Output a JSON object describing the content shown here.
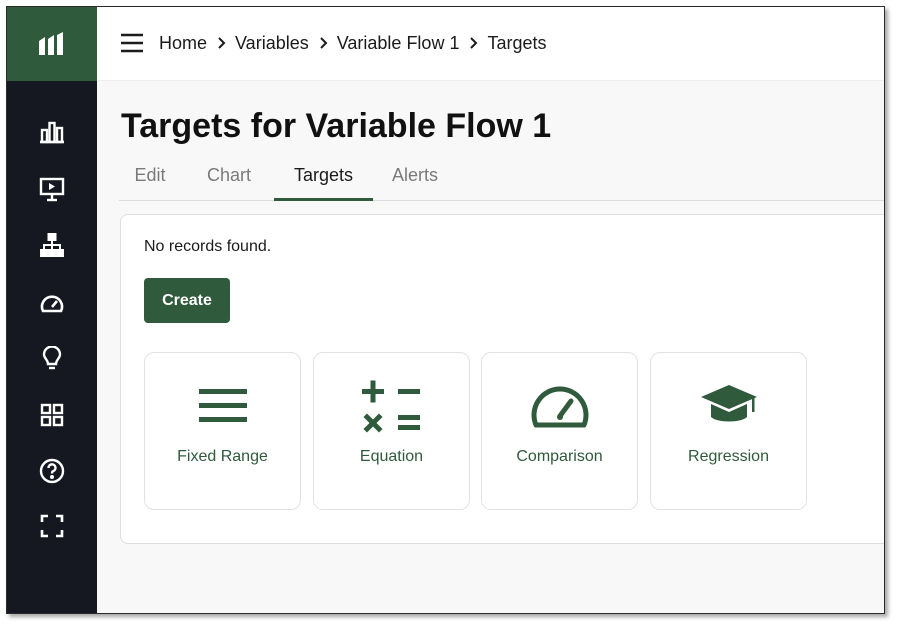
{
  "breadcrumb": [
    "Home",
    "Variables",
    "Variable Flow 1",
    "Targets"
  ],
  "page": {
    "title": "Targets for Variable Flow 1"
  },
  "tabs": [
    {
      "label": "Edit",
      "active": false
    },
    {
      "label": "Chart",
      "active": false
    },
    {
      "label": "Targets",
      "active": true
    },
    {
      "label": "Alerts",
      "active": false
    }
  ],
  "panel": {
    "empty_message": "No records found.",
    "create_label": "Create"
  },
  "target_types": [
    {
      "label": "Fixed Range",
      "icon": "bars-icon"
    },
    {
      "label": "Equation",
      "icon": "math-operators-icon"
    },
    {
      "label": "Comparison",
      "icon": "gauge-icon"
    },
    {
      "label": "Regression",
      "icon": "graduation-cap-icon"
    }
  ],
  "sidebar": {
    "icons": [
      "chart-bar-icon",
      "presentation-icon",
      "sitemap-icon",
      "speedometer-icon",
      "lightbulb-icon",
      "grid-icon",
      "help-icon",
      "fullscreen-icon"
    ]
  },
  "colors": {
    "brand": "#2f5a3b",
    "sidebar": "#151820"
  }
}
